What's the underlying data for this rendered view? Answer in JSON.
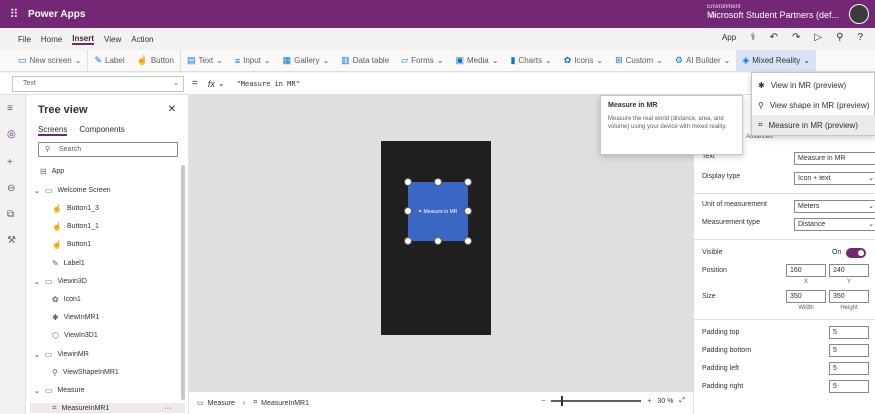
{
  "topbar": {
    "app_name": "Power Apps",
    "env_label": "Environment",
    "env_value": "Microsoft Student Partners (def..."
  },
  "menubar": {
    "items": [
      "File",
      "Home",
      "Insert",
      "View",
      "Action"
    ],
    "active": "Insert",
    "app_label": "App"
  },
  "ribbon": {
    "new_screen": "New screen",
    "label": "Label",
    "button": "Button",
    "text": "Text",
    "input": "Input",
    "gallery": "Gallery",
    "data_table": "Data table",
    "forms": "Forms",
    "media": "Media",
    "charts": "Charts",
    "icons": "Icons",
    "custom": "Custom",
    "ai_builder": "AI Builder",
    "mixed_reality": "Mixed Reality"
  },
  "formula": {
    "property": "Text",
    "eq": "=",
    "fx": "fx",
    "value": "\"Measure in MR\""
  },
  "tree": {
    "title": "Tree view",
    "tabs": [
      "Screens",
      "Components"
    ],
    "search_placeholder": "Search",
    "items": [
      {
        "label": "App",
        "icon": "app-icon"
      },
      {
        "label": "Welcome Screen",
        "icon": "screen-icon"
      },
      {
        "label": "Button1_3",
        "icon": "button-icon"
      },
      {
        "label": "Button1_1",
        "icon": "button-icon"
      },
      {
        "label": "Button1",
        "icon": "button-icon"
      },
      {
        "label": "Label1",
        "icon": "label-icon"
      },
      {
        "label": "Viewin3D",
        "icon": "screen-icon"
      },
      {
        "label": "Icon1",
        "icon": "icons-icon"
      },
      {
        "label": "ViewInMR1",
        "icon": "mr-icon"
      },
      {
        "label": "ViewIn3D1",
        "icon": "cube-icon"
      },
      {
        "label": "ViewinMR",
        "icon": "screen-icon"
      },
      {
        "label": "ViewShapeInMR1",
        "icon": "shape-icon"
      },
      {
        "label": "Measure",
        "icon": "screen-icon"
      },
      {
        "label": "MeasureInMR1",
        "icon": "measure-icon"
      }
    ]
  },
  "canvas": {
    "button_label": "Measure in MR"
  },
  "bottombar": {
    "screen": "Measure",
    "control": "MeasureInMR1",
    "zoom_minus": "−",
    "zoom_plus": "+",
    "zoom_value": "30 %"
  },
  "tooltip": {
    "title": "Measure in MR",
    "body": "Measure the real world (distance, area, and volume) using your device with mixed reality."
  },
  "dropdown": {
    "items": [
      "View in MR (preview)",
      "View shape in MR (preview)",
      "Measure in MR (preview)"
    ]
  },
  "props": {
    "advanced": "Advanced",
    "text_label": "Text",
    "text_value": "Measure in MR",
    "display_label": "Display type",
    "display_value": "Icon + text",
    "unit_label": "Unit of measurement",
    "unit_value": "Meters",
    "mtype_label": "Measurement type",
    "mtype_value": "Distance",
    "visible_label": "Visible",
    "visible_value": "On",
    "position_label": "Position",
    "pos_x": "160",
    "pos_y": "240",
    "x": "X",
    "y": "Y",
    "size_label": "Size",
    "width": "350",
    "height": "350",
    "width_label": "Width",
    "height_label": "Height",
    "pt_label": "Padding top",
    "pt": "5",
    "pb_label": "Padding bottom",
    "pb": "5",
    "pl_label": "Padding left",
    "pl": "5",
    "pr_label": "Padding right",
    "pr": "5"
  },
  "colors": {
    "brand": "#742774",
    "accent": "#0078d4",
    "button": "#3a66c4"
  }
}
